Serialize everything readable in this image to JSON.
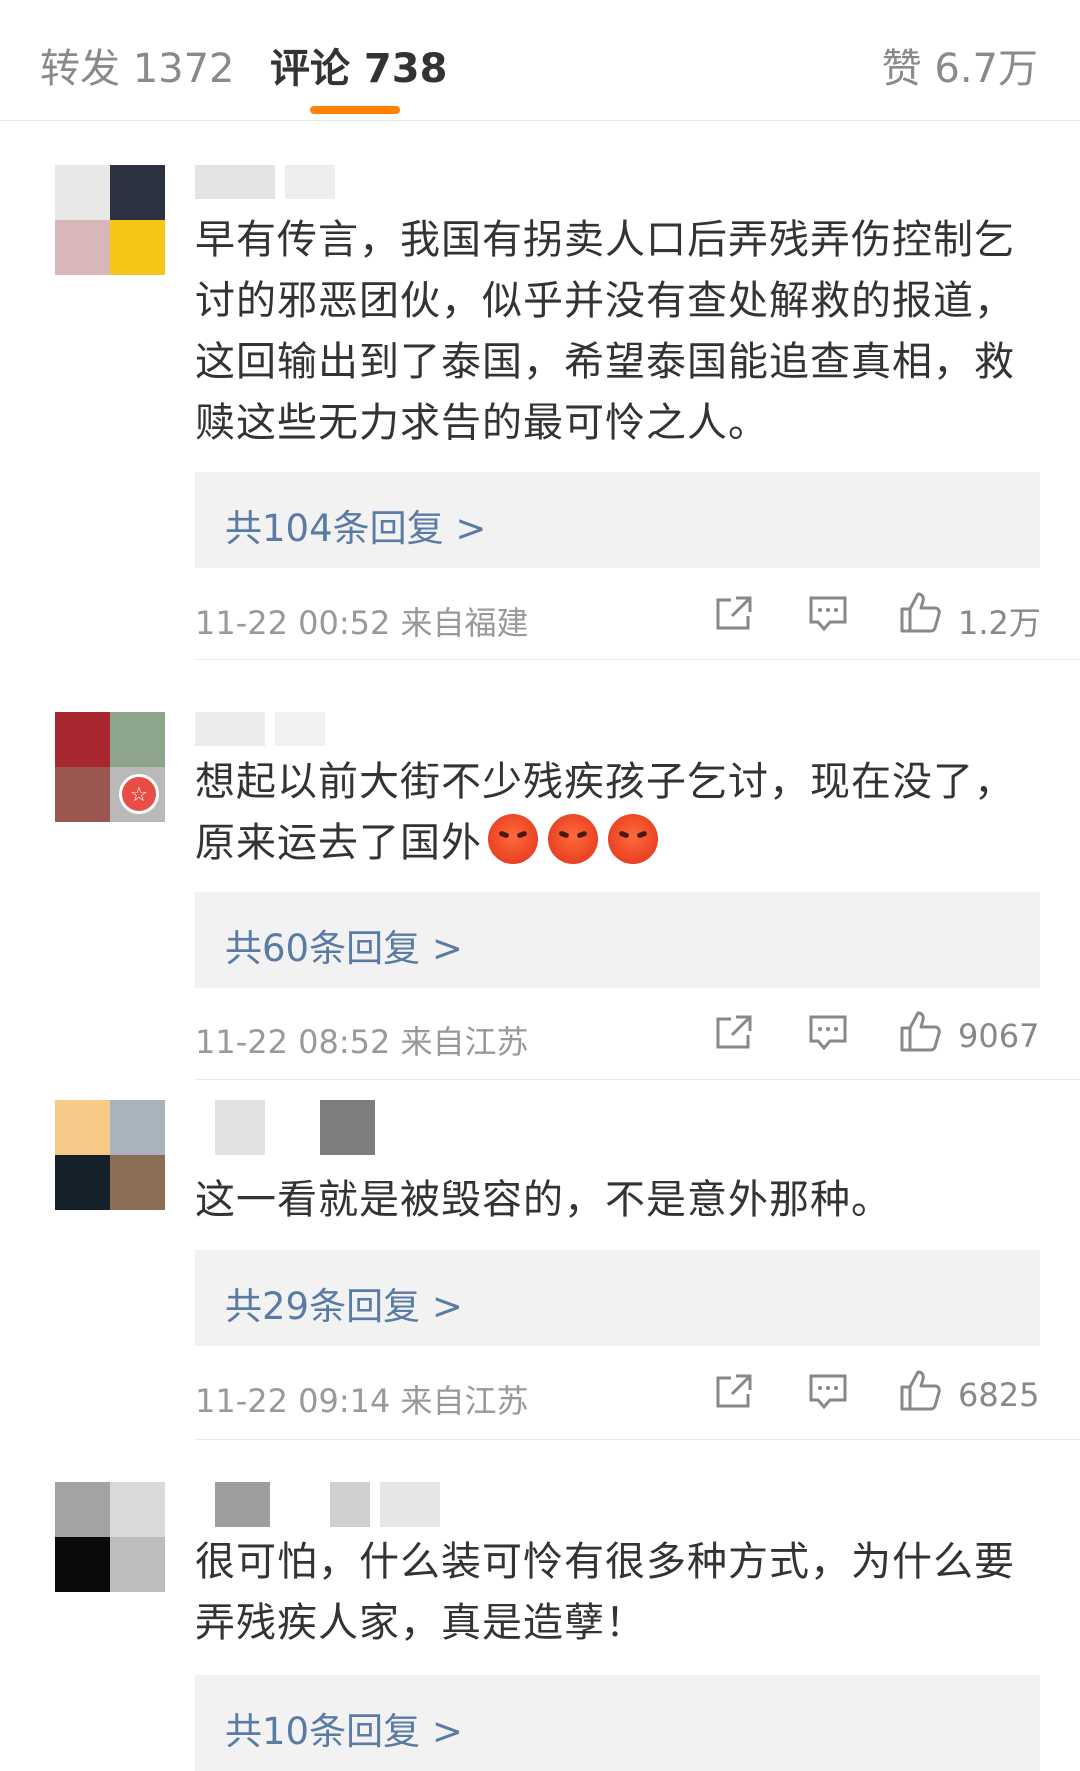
{
  "tabs": {
    "repost": "转发 1372",
    "comments": "评论 738",
    "likes": "赞 6.7万"
  },
  "colors": {
    "accent": "#ff8200",
    "link": "#5a7ba3",
    "reply_bg": "#f2f2f2"
  },
  "comments": [
    {
      "text": "早有传言，我国有拐卖人口后弄残弄伤控制乞讨的邪恶团伙，似乎并没有查处解救的报道，这回输出到了泰国，希望泰国能追查真相，救赎这些无力求告的最可怜之人。",
      "replies": "共104条回复 >",
      "meta": "11-22 00:52  来自福建",
      "likes": "1.2万"
    },
    {
      "text": "想起以前大街不少残疾孩子乞讨，现在没了，原来运去了国外",
      "emojis": [
        "angry-emoji",
        "angry-emoji",
        "angry-emoji"
      ],
      "replies": "共60条回复 >",
      "meta": "11-22 08:52  来自江苏",
      "likes": "9067"
    },
    {
      "text": "这一看就是被毁容的，不是意外那种。",
      "replies": "共29条回复 >",
      "meta": "11-22 09:14  来自江苏",
      "likes": "6825"
    },
    {
      "text": "很可怕，什么装可怜有很多种方式，为什么要弄残疾人家，真是造孽！",
      "replies": "共10条回复 >"
    }
  ]
}
